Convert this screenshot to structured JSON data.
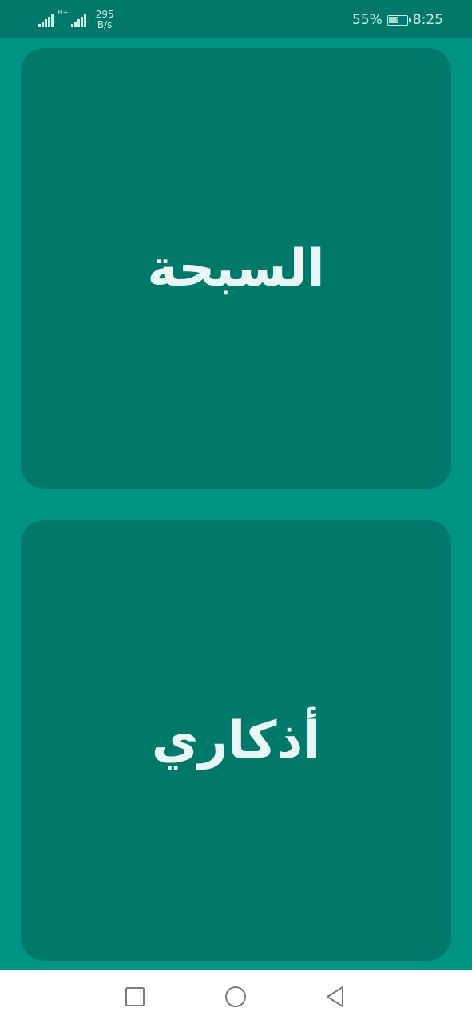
{
  "status_bar": {
    "net_speed_value": "295",
    "net_speed_unit": "B/s",
    "sim_label": "H+",
    "battery_percent": "55%",
    "battery_level": 0.55,
    "time": "8:25",
    "icons": [
      "signal-icon",
      "signal-icon",
      "battery-charging-icon"
    ]
  },
  "cards": [
    {
      "label": "السبحة"
    },
    {
      "label": "أذكاري"
    }
  ],
  "navigation": {
    "icons": [
      "recent-apps-icon",
      "home-icon",
      "back-icon"
    ]
  },
  "colors": {
    "background": "#009485",
    "status_bar": "#00786B",
    "card": "#00796B",
    "card_text": "#E8F6F4",
    "nav_bar": "#FFFFFF",
    "nav_icon": "#7A7A7A"
  }
}
